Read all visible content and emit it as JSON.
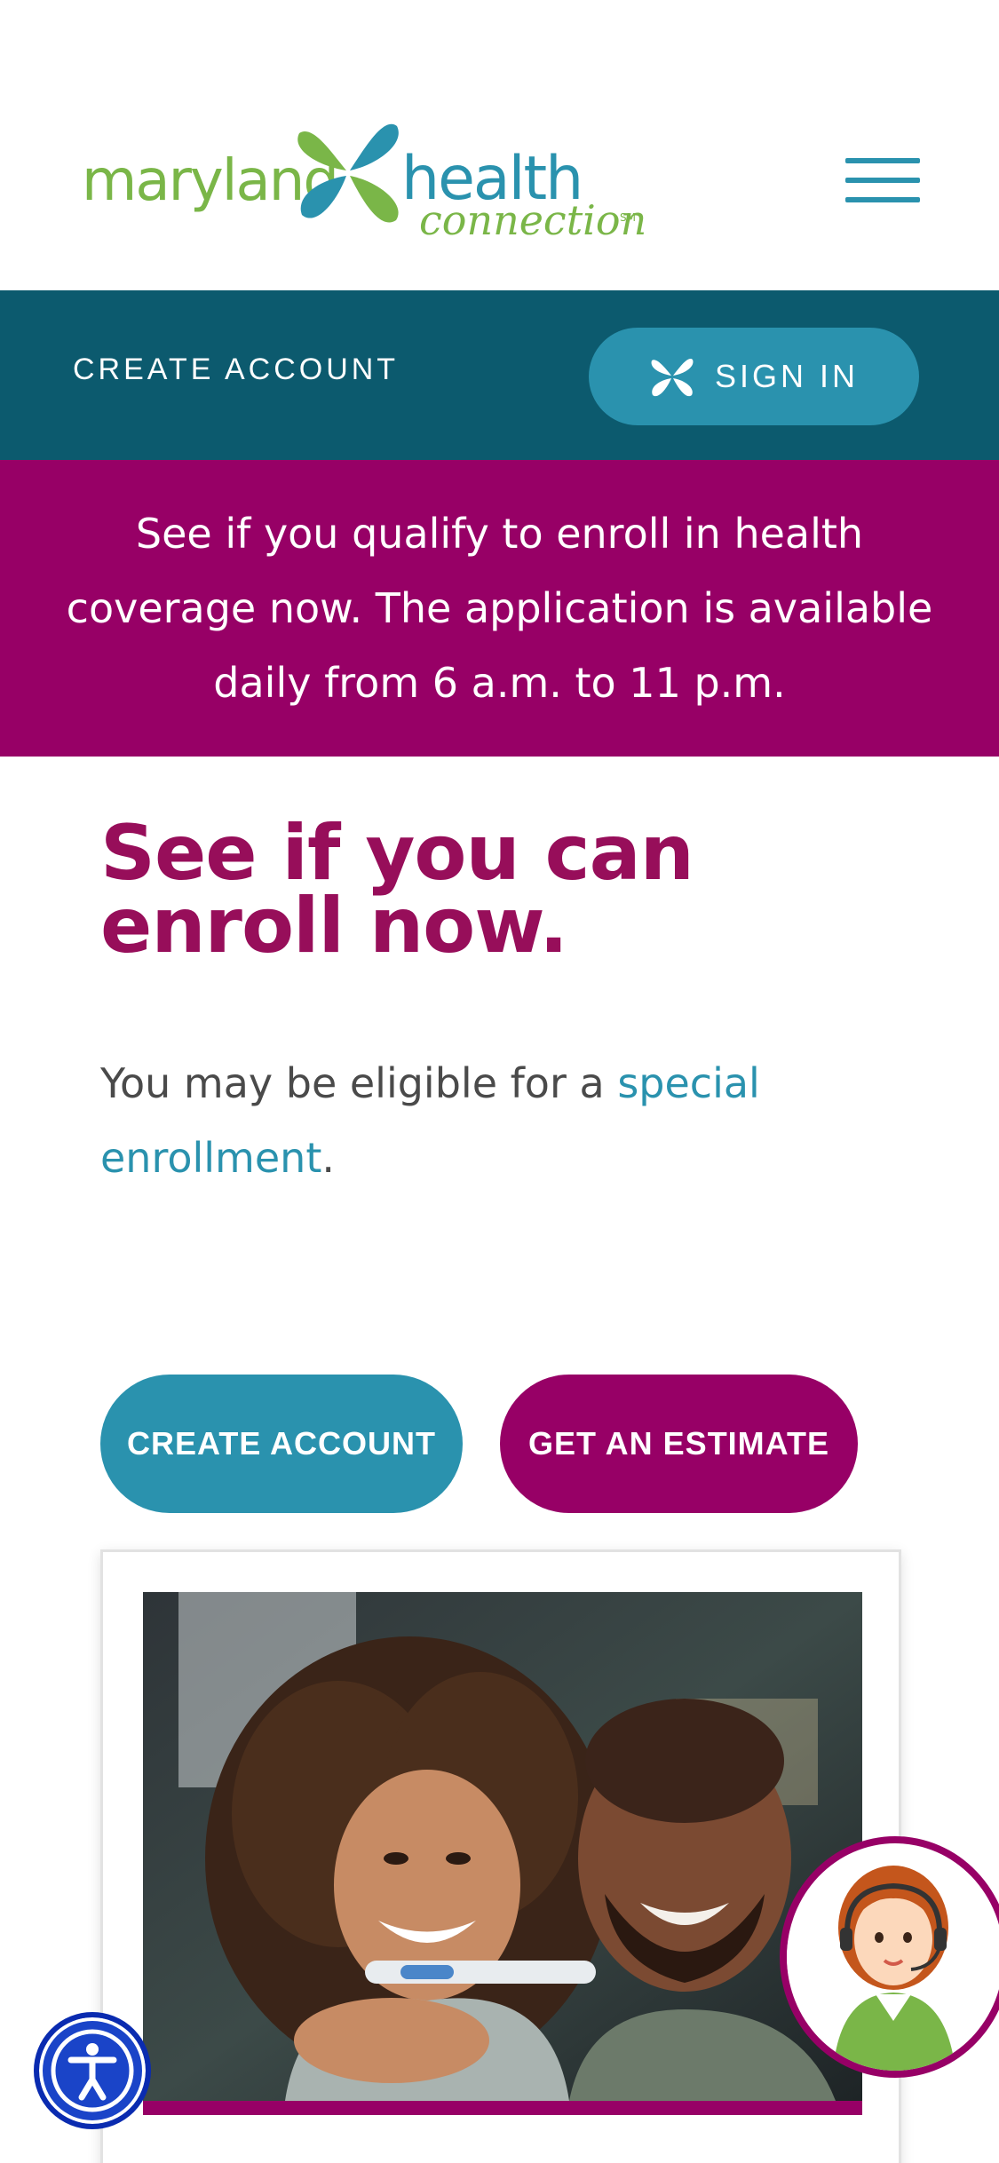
{
  "header": {
    "logo": {
      "part1": "maryland",
      "part2": "health",
      "part3": "connection",
      "service_mark": "SM"
    },
    "menu_icon": "hamburger-menu-icon"
  },
  "account_bar": {
    "create_account_label": "CREATE ACCOUNT",
    "sign_in_label": "SIGN IN",
    "sign_in_icon": "mhc-butterfly-icon"
  },
  "banner": {
    "text": "See if you qualify to enroll in health coverage now. The application is available daily from 6 a.m. to 11 p.m."
  },
  "main": {
    "headline": "See if you can enroll now.",
    "eligible_prefix": "You may be eligible for a ",
    "eligible_link": "special enrollment",
    "eligible_suffix": "."
  },
  "cta": {
    "create_account": "CREATE ACCOUNT",
    "get_estimate": "GET AN ESTIMATE"
  },
  "card": {
    "photo": "couple-with-pregnancy-test-photo"
  },
  "widgets": {
    "accessibility": "accessibility-icon",
    "chat_agent": "support-agent-avatar"
  },
  "colors": {
    "teal_dark": "#0c5a6e",
    "teal": "#2a92ae",
    "magenta": "#970066",
    "green": "#7ab648"
  }
}
